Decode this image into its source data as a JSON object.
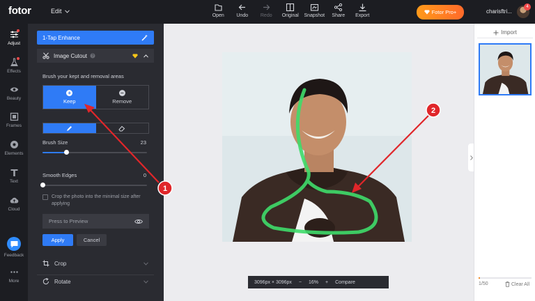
{
  "app": {
    "logo": "fotor",
    "edit_menu": "Edit",
    "pro_label": "Fotor Pro+",
    "username": "charisftri...",
    "notification_count": "4"
  },
  "toolbar": [
    {
      "label": "Open",
      "icon": "open-file-icon",
      "enabled": true
    },
    {
      "label": "Undo",
      "icon": "undo-arrow-icon",
      "enabled": true
    },
    {
      "label": "Redo",
      "icon": "redo-arrow-icon",
      "enabled": false
    },
    {
      "label": "Original",
      "icon": "original-image-icon",
      "enabled": true
    },
    {
      "label": "Snapshot",
      "icon": "snapshot-icon",
      "enabled": true
    },
    {
      "label": "Share",
      "icon": "share-icon",
      "enabled": true
    },
    {
      "label": "Export",
      "icon": "download-icon",
      "enabled": true
    }
  ],
  "rail": [
    {
      "label": "Adjust",
      "icon": "sliders-icon",
      "active": true,
      "dot": true
    },
    {
      "label": "Effects",
      "icon": "flask-icon",
      "active": false,
      "dot": true
    },
    {
      "label": "Beauty",
      "icon": "eye-icon",
      "active": false,
      "dot": false
    },
    {
      "label": "Frames",
      "icon": "frame-icon",
      "active": false,
      "dot": false
    },
    {
      "label": "Elements",
      "icon": "elements-icon",
      "active": false,
      "dot": false
    },
    {
      "label": "Text",
      "icon": "text-t-icon",
      "active": false,
      "dot": false
    },
    {
      "label": "Cloud",
      "icon": "cloud-upload-icon",
      "active": false,
      "dot": false
    },
    {
      "label": "Feedback",
      "icon": "feedback-bubble-icon",
      "active": false,
      "dot": false
    },
    {
      "label": "More",
      "icon": "more-dots-icon",
      "active": false,
      "dot": false
    }
  ],
  "panel": {
    "enhance_label": "1-Tap Enhance",
    "cutout_label": "Image Cutout",
    "hint": "Brush your kept and removal areas",
    "keep_label": "Keep",
    "remove_label": "Remove",
    "brush_size_label": "Brush Size",
    "brush_size_value": "23",
    "brush_size_fraction": 0.23,
    "smooth_edges_label": "Smooth Edges",
    "smooth_edges_value": "0",
    "smooth_edges_fraction": 0,
    "crop_checkbox_label": "Crop the photo into the minimal size after applying",
    "preview_label": "Press to Preview",
    "apply_label": "Apply",
    "cancel_label": "Cancel",
    "crop_label": "Crop",
    "rotate_label": "Rotate"
  },
  "canvas": {
    "dimensions": "3096px × 3096px",
    "zoom": "16%",
    "zoom_out": "−",
    "zoom_in": "+",
    "compare_label": "Compare"
  },
  "right": {
    "import_label": "Import",
    "count": "1/50",
    "clear_label": "Clear All",
    "usage_fraction": 0.02
  },
  "annotations": [
    {
      "label": "1"
    },
    {
      "label": "2"
    }
  ],
  "colors": {
    "accent": "#2f7bf6",
    "pro": "#ff8a1f",
    "annotation": "#e0262a",
    "brush": "#3fdc6a"
  }
}
